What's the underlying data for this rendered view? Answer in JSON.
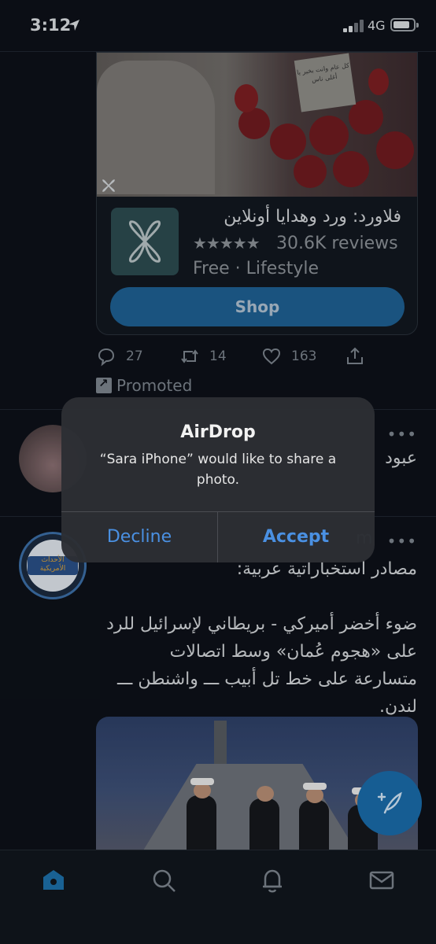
{
  "status_bar": {
    "time": "3:12",
    "network": "4G",
    "icons": [
      "location-arrow-icon",
      "signal-bars-icon",
      "battery-icon"
    ]
  },
  "ad": {
    "note_text": "كل عام وانت بخير يا أغلى ناس",
    "app_name": "فلاورد: ورد وهدايا أونلاين",
    "stars": "★★★★★",
    "reviews": "30.6K reviews",
    "meta": "Free · Lifestyle",
    "shop_label": "Shop"
  },
  "actions": {
    "reply_count": "27",
    "retweet_count": "14",
    "like_count": "163"
  },
  "promoted_label": "Promoted",
  "tweet2": {
    "text": "عبود",
    "more": "•••"
  },
  "tweet3": {
    "avatar_text": "الأحداث الأمريكية",
    "header_suffix": "m",
    "more": "•••",
    "line1": "مصادر استخباراتية عربية:",
    "para": "ضوء أخضر أميركي - بريطاني لإسرائيل للرد على «هجوم عُمان» وسط اتصالات متسارعة على خط تل أبيب ـــ واشنطن ـــ لندن."
  },
  "alert": {
    "title": "AirDrop",
    "message": "“Sara iPhone” would like to share a photo.",
    "decline": "Decline",
    "accept": "Accept"
  },
  "tabbar": {
    "tabs": [
      "home-icon",
      "search-icon",
      "notifications-icon",
      "messages-icon"
    ],
    "active_color": "#1d9bf0"
  },
  "colors": {
    "accent": "#4a90e2",
    "fab": "#1a6aa8",
    "background": "#0d1118"
  }
}
